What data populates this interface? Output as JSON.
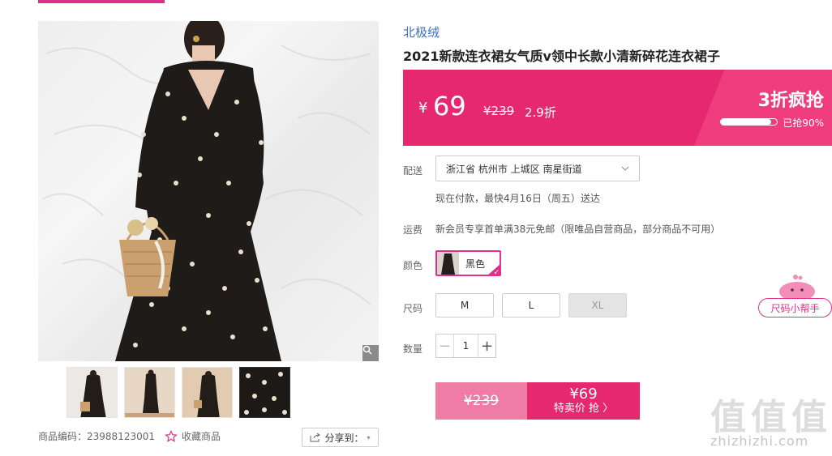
{
  "gallery": {
    "zoom_icon": "magnifier-icon",
    "product_code_label": "商品编码：",
    "product_code": "23988123001",
    "favorite_label": "收藏商品",
    "share_label": "分享到："
  },
  "product": {
    "brand": "北极绒",
    "title": "2021新款连衣裙女气质v领中长款小清新碎花连衣裙子"
  },
  "price": {
    "currency": "¥",
    "current": "69",
    "original": "¥239",
    "discount": "2.9折",
    "flash_title": "3折疯抢",
    "flash_progress": 0.9,
    "flash_text": "已抢90%"
  },
  "delivery": {
    "label": "配送",
    "address": "浙江省 杭州市 上城区 南星街道",
    "eta": "现在付款，最快4月16日（周五）送达"
  },
  "freight": {
    "label": "运费",
    "text": "新会员专享首单满38元免邮（限唯品自营商品，部分商品不可用）"
  },
  "color": {
    "label": "颜色",
    "selected": "黑色"
  },
  "size": {
    "label": "尺码",
    "options": [
      "M",
      "L",
      "XL"
    ]
  },
  "quantity": {
    "label": "数量",
    "value": "1",
    "minus": "−",
    "plus": "+"
  },
  "buy": {
    "original": "¥239",
    "price": "¥69",
    "label": "特卖价 抢 〉"
  },
  "helper": {
    "label": "尺码小帮手"
  },
  "watermark": {
    "chars": [
      "值",
      "值",
      "值"
    ],
    "url": "zhizhizhi.com"
  },
  "colors": {
    "accent": "#e0318a",
    "price_band": "#e6286f",
    "brand_link": "#3b6ec9"
  }
}
